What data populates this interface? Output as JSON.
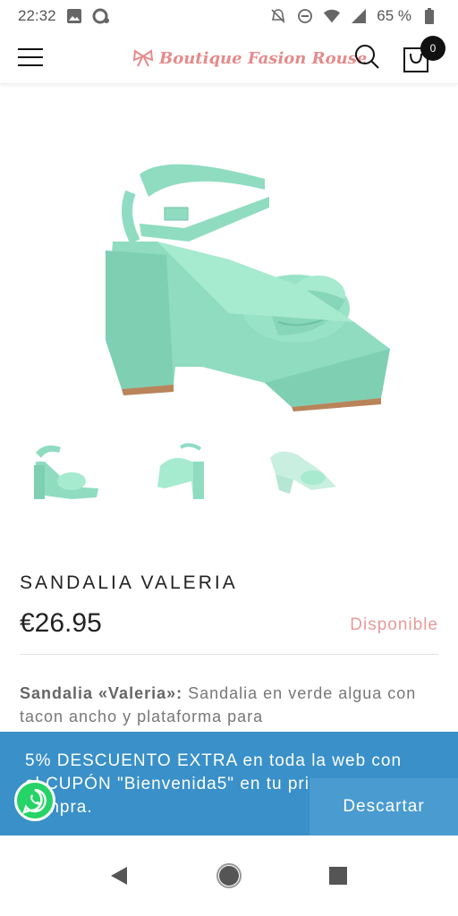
{
  "status_bar": {
    "time": "22:32",
    "battery": "65 %"
  },
  "header": {
    "logo_text": "Boutique Fasion Rouse",
    "cart_count": "0"
  },
  "product": {
    "title": "SANDALIA VALERIA",
    "price": "€26.95",
    "availability": "Disponible",
    "description_bold": "Sandalia «Valeria»:",
    "description": " Sandalia en verde algua con tacon ancho y plataforma para"
  },
  "promo": {
    "message": "5% DESCUENTO EXTRA en toda la web con el CUPÓN \"Bienvenida5\" en tu primera compra.",
    "dismiss_label": "Descartar"
  },
  "colors": {
    "product_mint": "#8fdcc0",
    "promo_blue": "#3a90c8",
    "availability_pink": "#e89a9a",
    "logo_pink": "#e58a8a",
    "whatsapp_green": "#25d366"
  },
  "icons": {
    "menu": "hamburger-icon",
    "search": "search-icon",
    "cart": "shopping-bag-icon",
    "whatsapp": "whatsapp-icon",
    "back": "back-triangle-icon",
    "home": "home-circle-icon",
    "recents": "recents-square-icon"
  }
}
